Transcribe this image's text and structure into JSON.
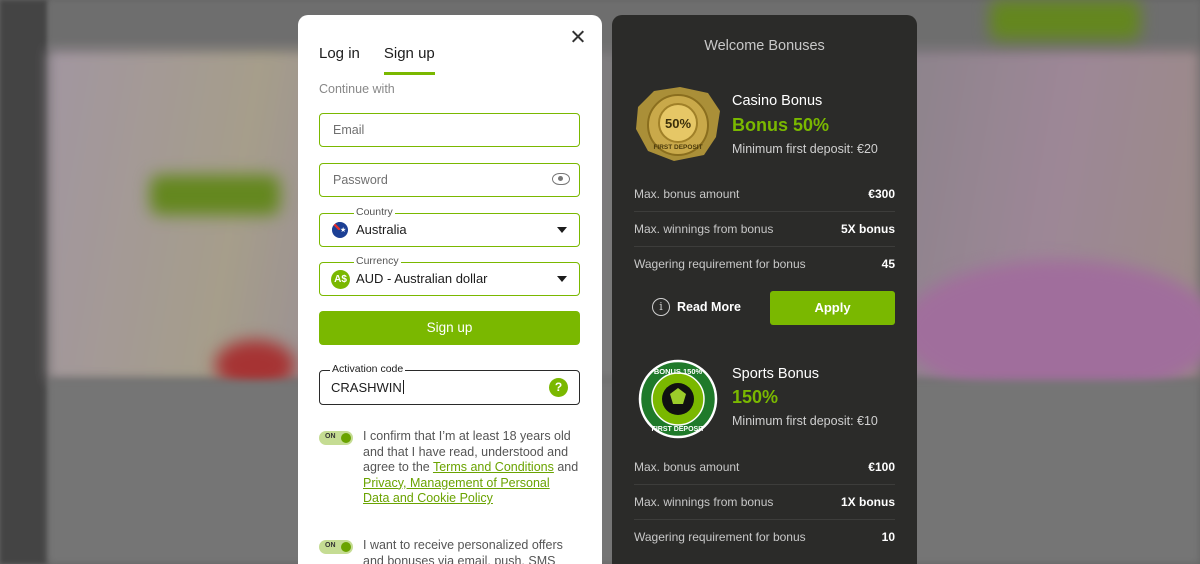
{
  "auth": {
    "tabs": [
      {
        "label": "Log in"
      },
      {
        "label": "Sign up"
      }
    ],
    "continue_with": "Continue with",
    "email_placeholder": "Email",
    "password_placeholder": "Password",
    "country": {
      "label": "Country",
      "value": "Australia"
    },
    "currency": {
      "label": "Currency",
      "value": "AUD - Australian dollar",
      "icon_text": "A$"
    },
    "signup_button": "Sign up",
    "activation": {
      "label": "Activation code",
      "value": "CRASHWIN",
      "help": "?"
    },
    "toggle_text": "ON",
    "consent1": {
      "text1": "I confirm that I’m at least 18 years old and that I have read, understood and agree to the ",
      "link1": "Terms and Conditions",
      "text2": " and ",
      "link2": "Privacy, Management of Personal Data and Cookie Policy"
    },
    "consent2": {
      "text": "I want to receive personalized offers and bonuses via email, push, SMS"
    }
  },
  "bonuses": {
    "title": "Welcome Bonuses",
    "casino": {
      "badge_text": "50%",
      "badge_sub": "FIRST DEPOSIT",
      "heading": "Casino Bonus",
      "amount": "Bonus 50%",
      "min_deposit": "Minimum first deposit: €20",
      "rows": [
        {
          "label": "Max. bonus amount",
          "value": "€300"
        },
        {
          "label": "Max. winnings from bonus",
          "value": "5X bonus"
        },
        {
          "label": "Wagering requirement for bonus",
          "value": "45"
        }
      ],
      "read_more": "Read More",
      "apply": "Apply"
    },
    "sports": {
      "badge_top": "BONUS 150%",
      "badge_bottom": "FIRST DEPOSIT",
      "heading": "Sports Bonus",
      "amount": "150%",
      "min_deposit": "Minimum first deposit: €10",
      "rows": [
        {
          "label": "Max. bonus amount",
          "value": "€100"
        },
        {
          "label": "Max. winnings from bonus",
          "value": "1X bonus"
        },
        {
          "label": "Wagering requirement for bonus",
          "value": "10"
        }
      ]
    }
  },
  "colors": {
    "accent": "#7ab800",
    "panel_dark": "#2b2b29"
  }
}
